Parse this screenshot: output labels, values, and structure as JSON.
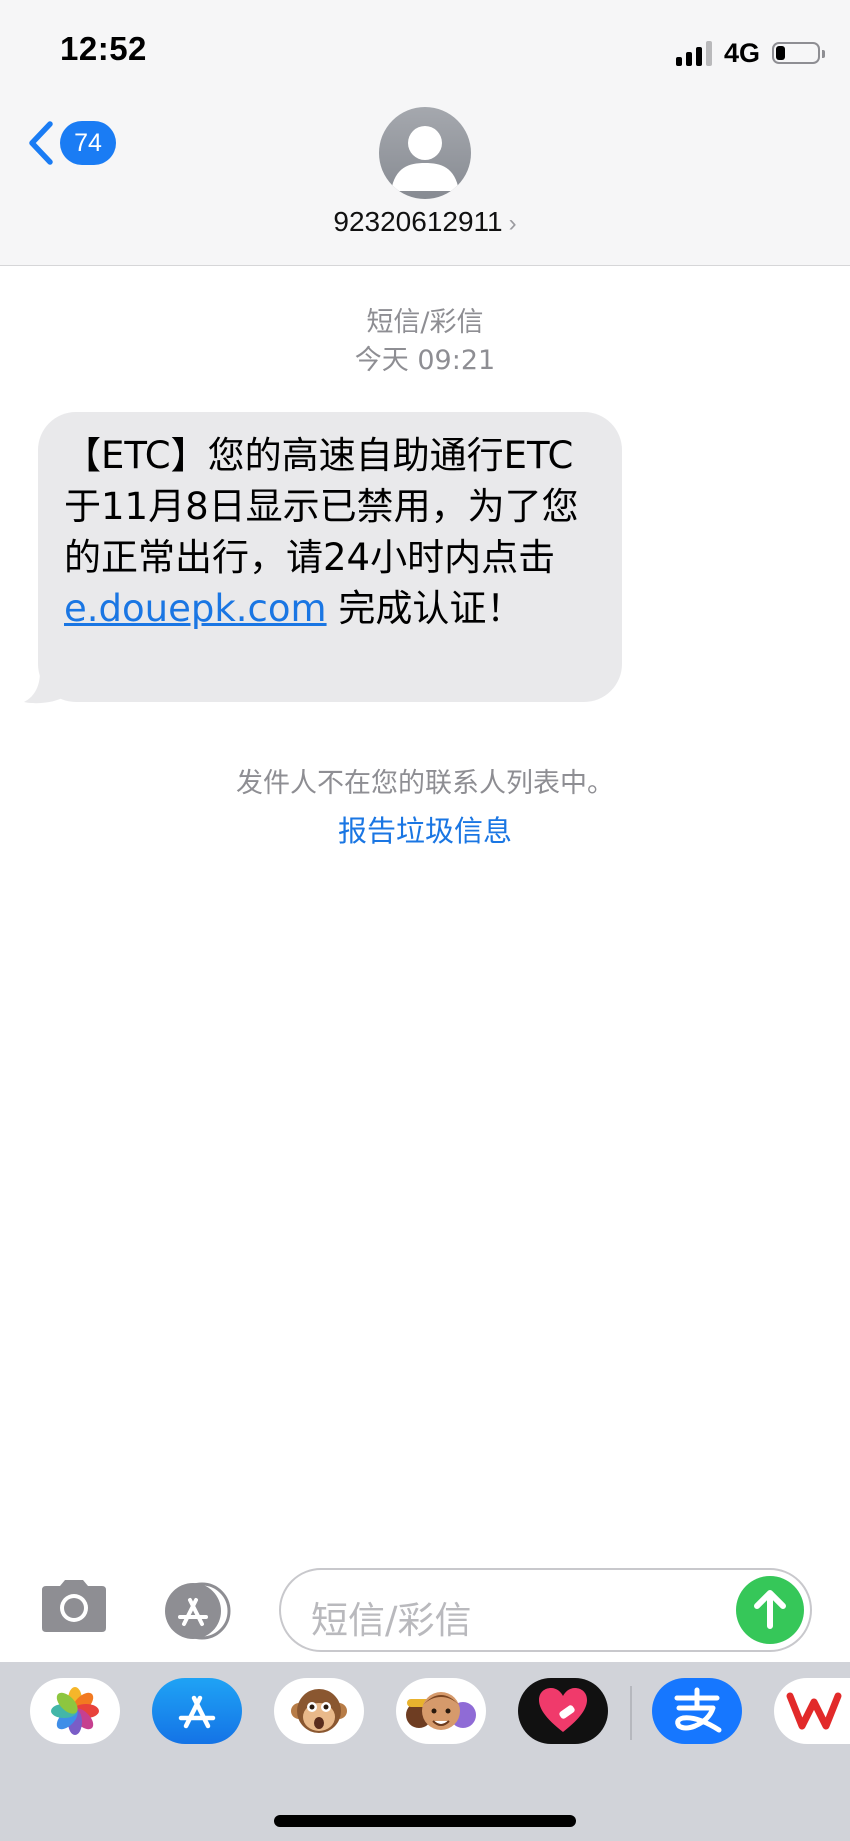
{
  "status_bar": {
    "time": "12:52",
    "network": "4G",
    "signal_bars_active": 3,
    "signal_bars_total": 4,
    "battery_level": 0.2
  },
  "header": {
    "back_badge_count": "74",
    "contact_number": "92320612911",
    "chevron_glyph": "›"
  },
  "conversation": {
    "service_label": "短信/彩信",
    "timestamp": "今天 09:21",
    "message": {
      "text_before_link": "【ETC】您的高速自助通行ETC于11月8日显示已禁用，为了您的正常出行，请24小时内点击",
      "link": "e.douepk.com",
      "text_after_link": " 完成认证！"
    },
    "sender_notice": "发件人不在您的联系人列表中。",
    "report_link": "报告垃圾信息"
  },
  "compose": {
    "placeholder": "短信/彩信"
  },
  "app_drawer": {
    "apps": [
      {
        "name": "photos-app-icon"
      },
      {
        "name": "app-store-app-icon"
      },
      {
        "name": "animoji-app-icon"
      },
      {
        "name": "memoji-app-icon"
      },
      {
        "name": "digital-touch-app-icon"
      },
      {
        "name": "alipay-app-icon"
      },
      {
        "name": "wps-app-icon"
      }
    ]
  },
  "colors": {
    "accent_blue": "#1a7cf4",
    "link_blue": "#1a76e3",
    "send_green": "#36c759",
    "bubble_gray": "#e9e9eb",
    "header_bg": "#f6f6f7",
    "drawer_bg": "#d1d3d9"
  }
}
